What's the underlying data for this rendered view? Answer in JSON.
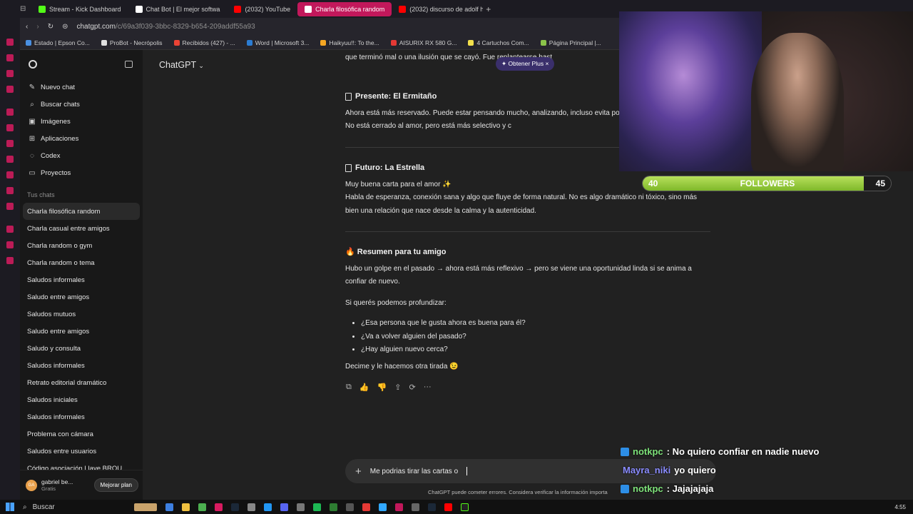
{
  "browser": {
    "tabs": [
      {
        "label": "Stream - Kick Dashboard",
        "color": "#53fc18"
      },
      {
        "label": "Chat Bot | El mejor softwa",
        "color": "#ffffff"
      },
      {
        "label": "(2032) YouTube",
        "color": "#ff0000"
      },
      {
        "label": "Charla filosófica random",
        "color": "#ffffff"
      },
      {
        "label": "(2032) discurso de adolf h",
        "color": "#ff0000"
      }
    ],
    "url_host": "chatgpt.com",
    "url_path": "/c/69a3f039-3bbc-8329-b654-209addf55a93",
    "bookmarks": [
      {
        "label": "Estado | Epson Co...",
        "color": "#4a90e2"
      },
      {
        "label": "ProBot - Necrópolis",
        "color": "#e0e0e0"
      },
      {
        "label": "Recibidos (427) - ...",
        "color": "#ea4335"
      },
      {
        "label": "Word | Microsoft 3...",
        "color": "#2b7cd3"
      },
      {
        "label": "Haikyuu!!: To the...",
        "color": "#f5a623"
      },
      {
        "label": "AISURIX RX 580 G...",
        "color": "#e53935"
      },
      {
        "label": "4 Cartuchos Com...",
        "color": "#f3e04c"
      },
      {
        "label": "Página Principal |...",
        "color": "#8bc34a"
      }
    ]
  },
  "sidebar": {
    "nav": [
      {
        "label": "Nuevo chat",
        "icon": "✎"
      },
      {
        "label": "Buscar chats",
        "icon": "⌕"
      },
      {
        "label": "Imágenes",
        "icon": "▣"
      },
      {
        "label": "Aplicaciones",
        "icon": "⊞"
      },
      {
        "label": "Codex",
        "icon": "◌"
      },
      {
        "label": "Proyectos",
        "icon": "▭"
      }
    ],
    "section_title": "Tus chats",
    "chats": [
      "Charla filosófica random",
      "Charla casual entre amigos",
      "Charla random o gym",
      "Charla random o tema",
      "Saludos informales",
      "Saludo entre amigos",
      "Saludos mutuos",
      "Saludo entre amigos",
      "Saludo y consulta",
      "Saludos informales",
      "Retrato editorial dramático",
      "Saludos iniciales",
      "Saludos informales",
      "Problema con cámara",
      "Saludos entre usuarios",
      "Código asociación Llave BROU"
    ],
    "user": {
      "initials": "GA",
      "name": "gabriel be...",
      "plan": "Gratis",
      "upgrade_label": "Mejorar plan"
    }
  },
  "main": {
    "model_label": "ChatGPT",
    "plus_pill": "✦ Obtener Plus  ×",
    "top_fragment": "que terminó mal o una ilusión que se cayó. Fue                               replantearse bast",
    "present_title": "Presente: El Ermitaño",
    "present_text": "Ahora está más reservado. Puede estar pensando mucho, analizando, incluso evita por miedo a repetir lo mismo. No está cerrado al amor, pero está más selectivo y c",
    "future_title": "Futuro: La Estrella",
    "future_line1": "Muy buena carta para el amor ✨",
    "future_line2": "Habla de esperanza, conexión sana y algo que fluye de forma natural. No es algo dramático ni tóxico, sino más bien una relación que nace desde la calma y la autenticidad.",
    "summary_title": "🔥 Resumen para tu amigo",
    "summary_text": "Hubo un golpe en el pasado → ahora está más reflexivo → pero se viene una oportunidad linda si se anima a confiar de nuevo.",
    "deepen_intro": "Si querés podemos profundizar:",
    "questions": [
      "¿Esa persona que le gusta ahora es buena para él?",
      "¿Va a volver alguien del pasado?",
      "¿Hay alguien nuevo cerca?"
    ],
    "closing": "Decime y le hacemos otra tirada 😉",
    "actions": [
      "⧉",
      "👍",
      "👎",
      "⇪",
      "⟳",
      "···"
    ],
    "input_value": "Me podrias tirar las cartas o",
    "disclaimer": "ChatGPT puede cometer errores. Considera verificar la información importa"
  },
  "overlay": {
    "followers_label": "FOLLOWERS",
    "followers_current": "40",
    "followers_goal": "45",
    "followers_progress": 0.89,
    "chat_messages": [
      {
        "user": "notkpc",
        "text": ": No quiero confiar en nadie nuevo",
        "style": "nm1"
      },
      {
        "user": "Mayra_niki",
        "text": "yo quiero",
        "style": "nm2"
      },
      {
        "user": "notkpc",
        "text": ": Jajajajaja",
        "style": "nm1"
      }
    ]
  },
  "taskbar": {
    "search_label": "Buscar",
    "time": "4:55"
  }
}
